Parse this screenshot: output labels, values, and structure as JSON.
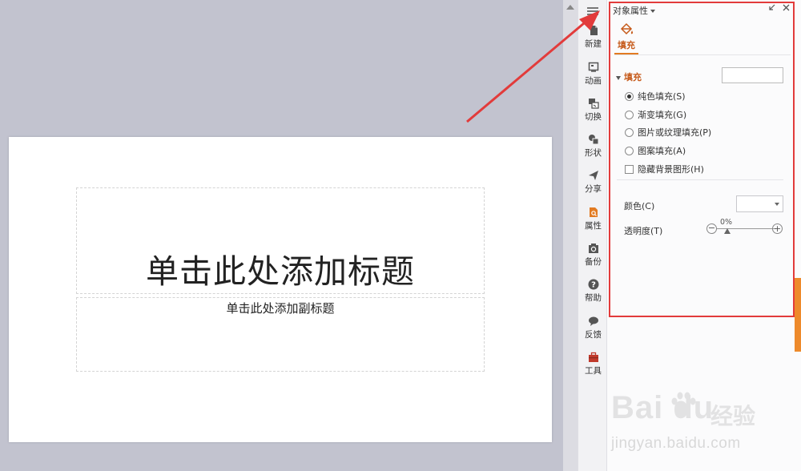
{
  "slide": {
    "title_placeholder": "单击此处添加标题",
    "subtitle_placeholder": "单击此处添加副标题"
  },
  "rail": {
    "items": [
      {
        "label": "新建",
        "icon": "new-doc-icon"
      },
      {
        "label": "动画",
        "icon": "animation-icon"
      },
      {
        "label": "切换",
        "icon": "transition-icon"
      },
      {
        "label": "形状",
        "icon": "shapes-icon"
      },
      {
        "label": "分享",
        "icon": "share-icon"
      },
      {
        "label": "属性",
        "icon": "properties-icon"
      },
      {
        "label": "备份",
        "icon": "backup-icon"
      },
      {
        "label": "帮助",
        "icon": "help-icon"
      },
      {
        "label": "反馈",
        "icon": "feedback-icon"
      },
      {
        "label": "工具",
        "icon": "toolbox-icon"
      }
    ],
    "active": "属性"
  },
  "panel": {
    "title": "对象属性",
    "tab_label": "填充",
    "section_label": "填充",
    "options": [
      {
        "label": "纯色填充(S)",
        "type": "radio",
        "checked": true
      },
      {
        "label": "渐变填充(G)",
        "type": "radio",
        "checked": false
      },
      {
        "label": "图片或纹理填充(P)",
        "type": "radio",
        "checked": false
      },
      {
        "label": "图案填充(A)",
        "type": "radio",
        "checked": false
      },
      {
        "label": "隐藏背景图形(H)",
        "type": "checkbox",
        "checked": false
      }
    ],
    "color_label": "颜色(C)",
    "transparency_label": "透明度(T)",
    "transparency_value": "0%",
    "transparency_level": 0
  },
  "watermark": {
    "logo": "Bai du",
    "brand_cn": "经验",
    "url": "jingyan.baidu.com"
  },
  "colors": {
    "accent": "#e27b22",
    "annotation": "#e23b3b",
    "canvas_bg": "#c2c3cf"
  }
}
